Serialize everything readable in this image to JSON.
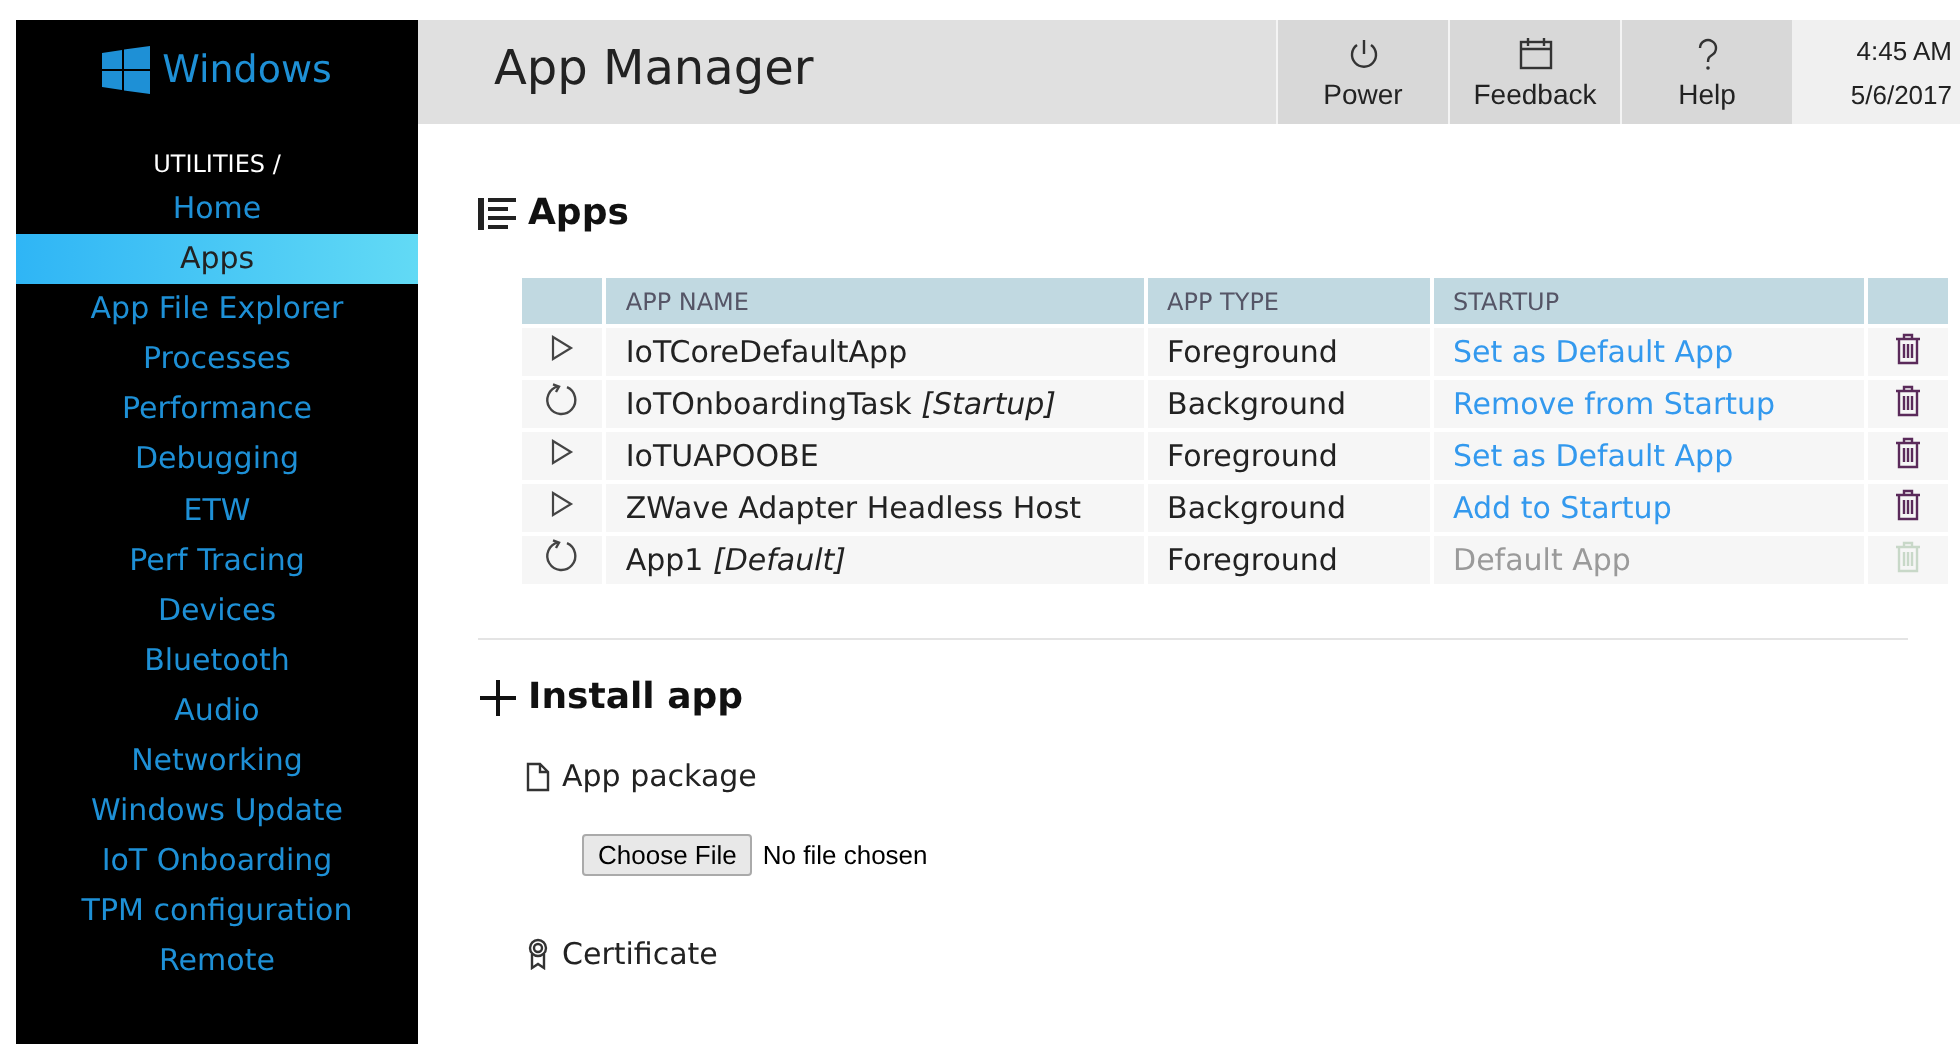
{
  "sidebar": {
    "logo": "Windows",
    "section": "UTILITIES /",
    "items": [
      {
        "label": "Home",
        "selected": false
      },
      {
        "label": "Apps",
        "selected": true
      },
      {
        "label": "App File Explorer",
        "selected": false
      },
      {
        "label": "Processes",
        "selected": false
      },
      {
        "label": "Performance",
        "selected": false
      },
      {
        "label": "Debugging",
        "selected": false
      },
      {
        "label": "ETW",
        "selected": false
      },
      {
        "label": "Perf Tracing",
        "selected": false
      },
      {
        "label": "Devices",
        "selected": false
      },
      {
        "label": "Bluetooth",
        "selected": false
      },
      {
        "label": "Audio",
        "selected": false
      },
      {
        "label": "Networking",
        "selected": false
      },
      {
        "label": "Windows Update",
        "selected": false
      },
      {
        "label": "IoT Onboarding",
        "selected": false
      },
      {
        "label": "TPM configuration",
        "selected": false
      },
      {
        "label": "Remote",
        "selected": false
      }
    ]
  },
  "header": {
    "title": "App Manager",
    "buttons": [
      {
        "label": "Power",
        "kind": "power"
      },
      {
        "label": "Feedback",
        "kind": "feedback"
      },
      {
        "label": "Help",
        "kind": "help"
      }
    ],
    "time": "4:45 AM",
    "date": "5/6/2017"
  },
  "apps": {
    "heading": "Apps",
    "columns": [
      "APP NAME",
      "APP TYPE",
      "STARTUP"
    ],
    "rows": [
      {
        "kind": "start",
        "name": "IoTCoreDefaultApp",
        "type": "Foreground",
        "startup": "Set as Default App",
        "disabled": false
      },
      {
        "kind": "restart",
        "name": "IoTOnboardingTask *[Startup]*",
        "type": "Background",
        "startup": "Remove from Startup",
        "disabled": false
      },
      {
        "kind": "start",
        "name": "IoTUAPOOBE",
        "type": "Foreground",
        "startup": "Set as Default App",
        "disabled": false
      },
      {
        "kind": "start",
        "name": "ZWave Adapter Headless Host",
        "type": "Background",
        "startup": "Add to Startup",
        "disabled": false
      },
      {
        "kind": "restart",
        "name": "App1 *[Default]*",
        "type": "Foreground",
        "startup": "Default App",
        "disabled": true
      }
    ]
  },
  "install": {
    "heading": "Install app",
    "package_label": "App package",
    "file_button": "Choose File",
    "file_status": "No file chosen",
    "certificate_label": "Certificate"
  }
}
